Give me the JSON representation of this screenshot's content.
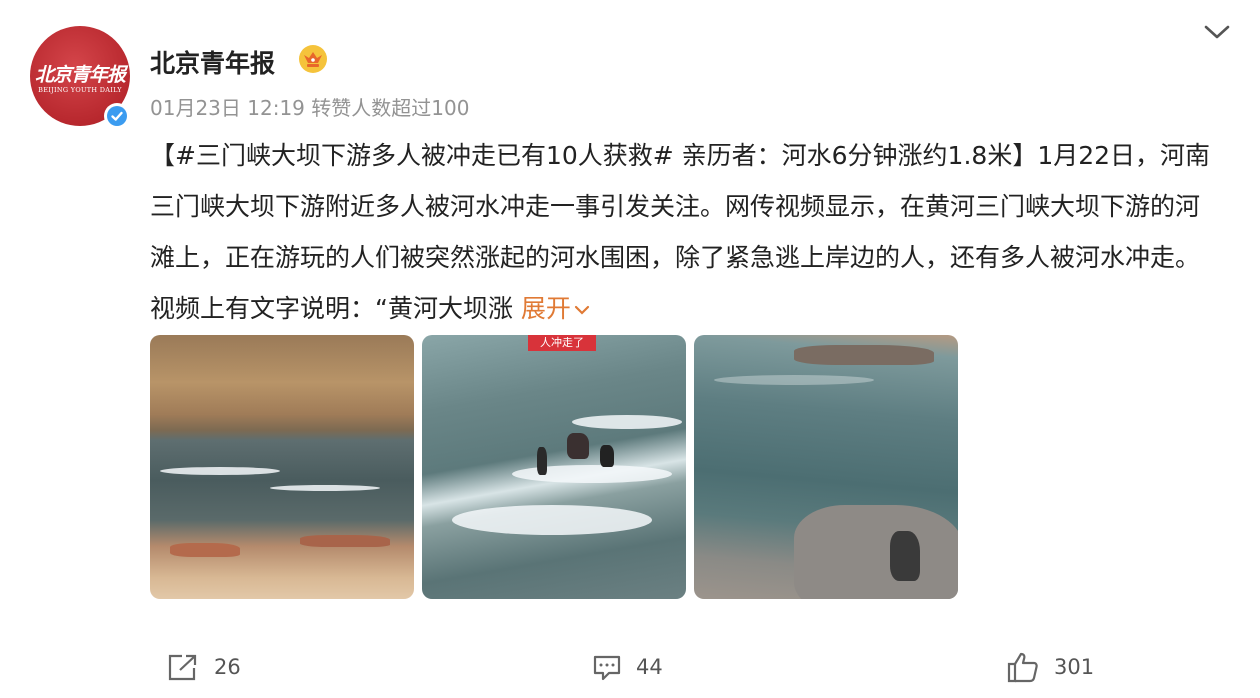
{
  "post": {
    "author": "北京青年报",
    "avatar_logo_text": "北京青年报",
    "avatar_logo_en": "BEIJING YOUTH DAILY",
    "date": "01月23日",
    "time": "12:19",
    "likes_note": "转赞人数超过100",
    "text": "【#三门峡大坝下游多人被冲走已有10人获救# 亲历者：河水6分钟涨约1.8米】1月22日，河南三门峡大坝下游附近多人被河水冲走一事引发关注。网传视频显示，在黄河三门峡大坝下游的河滩上，正在游玩的人们被突然涨起的河水围困，除了紧急逃上岸边的人，还有多人被河水冲走。视频上有文字说明：“黄河大坝涨",
    "expand_label": "展开",
    "photo2_banner": "人冲走了"
  },
  "actions": {
    "share_count": "26",
    "comment_count": "44",
    "like_count": "301"
  },
  "icons": [
    "chevron-down-icon",
    "crown-icon",
    "verified-icon",
    "share-icon",
    "comment-icon",
    "like-icon"
  ],
  "colors": {
    "expand": "#e07a35",
    "meta": "#939393",
    "avatar": "#b8282e",
    "verified": "#3b9cf0"
  }
}
